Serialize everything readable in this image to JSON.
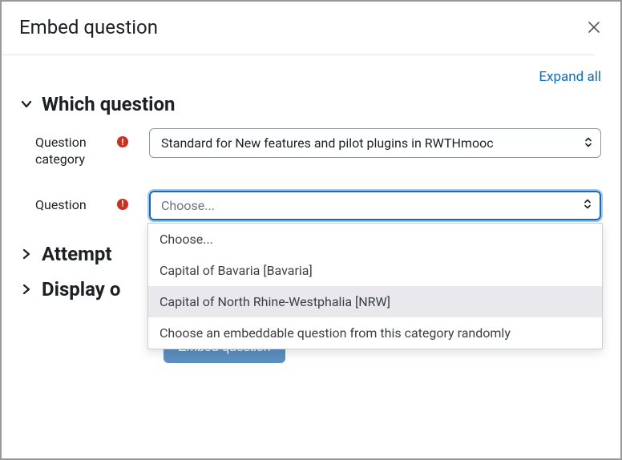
{
  "modal": {
    "title": "Embed question",
    "expand_all": "Expand all"
  },
  "sections": {
    "which_question": "Which question",
    "attempt": "Attempt",
    "display": "Display o"
  },
  "form": {
    "category_label": "Question category",
    "category_value": "Standard for New features and pilot plugins in RWTHmooc",
    "question_label": "Question",
    "question_value": "Choose...",
    "question_options": [
      "Choose...",
      "Capital of Bavaria [Bavaria]",
      "Capital of North Rhine-Westphalia [NRW]",
      "Choose an embeddable question from this category randomly"
    ]
  },
  "actions": {
    "embed": "Embed question"
  }
}
